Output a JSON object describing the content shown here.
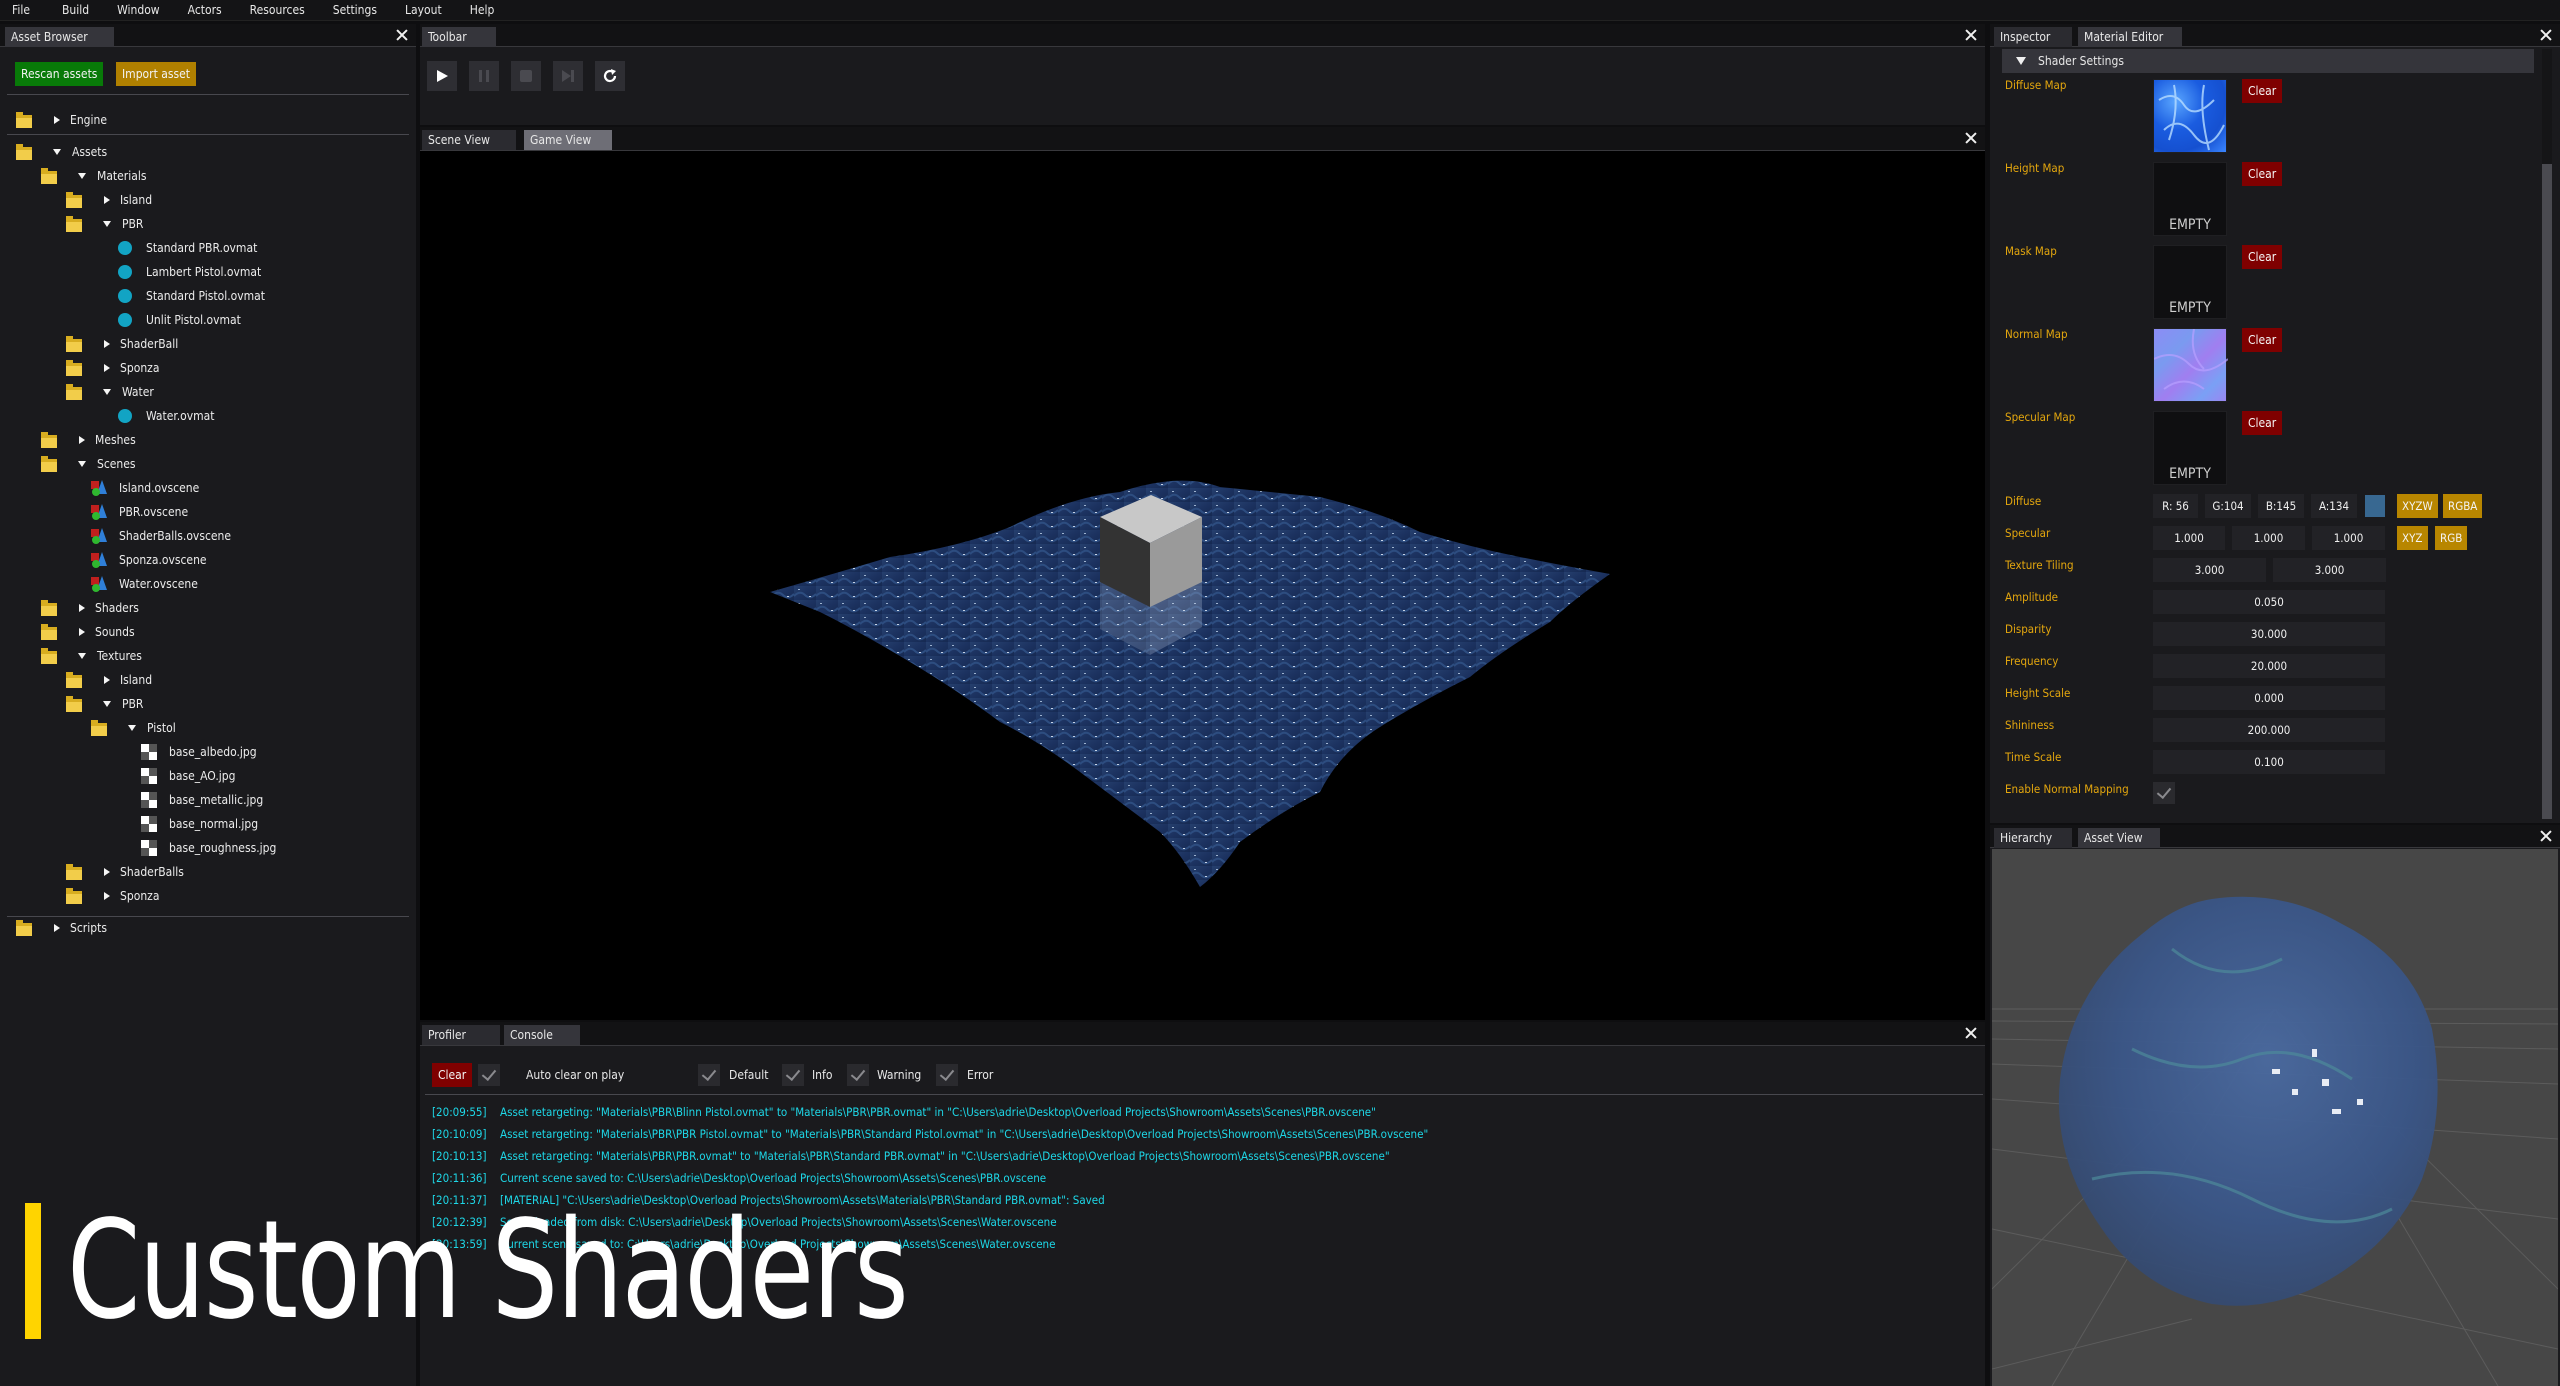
{
  "menu": [
    "File",
    "Build",
    "Window",
    "Actors",
    "Resources",
    "Settings",
    "Layout",
    "Help"
  ],
  "asset_browser": {
    "tab": "Asset Browser",
    "rescan_label": "Rescan assets",
    "import_label": "Import asset",
    "tree": [
      {
        "label": "Engine",
        "icon": "folder",
        "depth": 0,
        "state": "collapsed",
        "group": "engine"
      },
      {
        "label": "Assets",
        "icon": "folder",
        "depth": 0,
        "state": "expanded",
        "group": "assets"
      },
      {
        "label": "Materials",
        "icon": "folder",
        "depth": 1,
        "state": "expanded"
      },
      {
        "label": "Island",
        "icon": "folder",
        "depth": 2,
        "state": "collapsed"
      },
      {
        "label": "PBR",
        "icon": "folder",
        "depth": 2,
        "state": "expanded"
      },
      {
        "label": "Standard PBR.ovmat",
        "icon": "material",
        "depth": 3
      },
      {
        "label": "Lambert Pistol.ovmat",
        "icon": "material",
        "depth": 3
      },
      {
        "label": "Standard Pistol.ovmat",
        "icon": "material",
        "depth": 3
      },
      {
        "label": "Unlit Pistol.ovmat",
        "icon": "material",
        "depth": 3
      },
      {
        "label": "ShaderBall",
        "icon": "folder",
        "depth": 2,
        "state": "collapsed"
      },
      {
        "label": "Sponza",
        "icon": "folder",
        "depth": 2,
        "state": "collapsed"
      },
      {
        "label": "Water",
        "icon": "folder",
        "depth": 2,
        "state": "expanded"
      },
      {
        "label": "Water.ovmat",
        "icon": "material",
        "depth": 3
      },
      {
        "label": "Meshes",
        "icon": "folder",
        "depth": 1,
        "state": "collapsed"
      },
      {
        "label": "Scenes",
        "icon": "folder",
        "depth": 1,
        "state": "expanded"
      },
      {
        "label": "Island.ovscene",
        "icon": "scene",
        "depth": 2
      },
      {
        "label": "PBR.ovscene",
        "icon": "scene",
        "depth": 2
      },
      {
        "label": "ShaderBalls.ovscene",
        "icon": "scene",
        "depth": 2
      },
      {
        "label": "Sponza.ovscene",
        "icon": "scene",
        "depth": 2
      },
      {
        "label": "Water.ovscene",
        "icon": "scene",
        "depth": 2
      },
      {
        "label": "Shaders",
        "icon": "folder",
        "depth": 1,
        "state": "collapsed"
      },
      {
        "label": "Sounds",
        "icon": "folder",
        "depth": 1,
        "state": "collapsed"
      },
      {
        "label": "Textures",
        "icon": "folder",
        "depth": 1,
        "state": "expanded"
      },
      {
        "label": "Island",
        "icon": "folder",
        "depth": 2,
        "state": "collapsed"
      },
      {
        "label": "PBR",
        "icon": "folder",
        "depth": 2,
        "state": "expanded"
      },
      {
        "label": "Pistol",
        "icon": "folder",
        "depth": 3,
        "state": "expanded"
      },
      {
        "label": "base_albedo.jpg",
        "icon": "texture",
        "depth": 4
      },
      {
        "label": "base_AO.jpg",
        "icon": "texture",
        "depth": 4
      },
      {
        "label": "base_metallic.jpg",
        "icon": "texture",
        "depth": 4
      },
      {
        "label": "base_normal.jpg",
        "icon": "texture",
        "depth": 4
      },
      {
        "label": "base_roughness.jpg",
        "icon": "texture",
        "depth": 4
      },
      {
        "label": "ShaderBalls",
        "icon": "folder",
        "depth": 2,
        "state": "collapsed"
      },
      {
        "label": "Sponza",
        "icon": "folder",
        "depth": 2,
        "state": "collapsed"
      },
      {
        "label": "Scripts",
        "icon": "folder",
        "depth": 0,
        "state": "collapsed",
        "group": "scripts"
      }
    ]
  },
  "toolbar": {
    "tab": "Toolbar",
    "buttons": [
      {
        "name": "play",
        "enabled": true
      },
      {
        "name": "pause",
        "enabled": false
      },
      {
        "name": "stop",
        "enabled": false
      },
      {
        "name": "next-frame",
        "enabled": false
      },
      {
        "name": "refresh",
        "enabled": true
      }
    ]
  },
  "viewport": {
    "tabs": [
      "Scene View",
      "Game View"
    ],
    "active_tab": "Game View"
  },
  "console": {
    "tabs": [
      "Profiler",
      "Console"
    ],
    "active_tab": "Console",
    "clear_label": "Clear",
    "auto_clear_label": "Auto clear on play",
    "auto_clear_checked": true,
    "filters": [
      {
        "label": "Default",
        "checked": true
      },
      {
        "label": "Info",
        "checked": true
      },
      {
        "label": "Warning",
        "checked": true
      },
      {
        "label": "Error",
        "checked": true
      }
    ],
    "logs": [
      {
        "time": "[20:09:55]",
        "message": "Asset retargeting: \"Materials\\PBR\\Blinn Pistol.ovmat\" to \"Materials\\PBR\\PBR.ovmat\" in \"C:\\Users\\adrie\\Desktop\\Overload Projects\\Showroom\\Assets\\Scenes\\PBR.ovscene\""
      },
      {
        "time": "[20:10:09]",
        "message": "Asset retargeting: \"Materials\\PBR\\PBR Pistol.ovmat\" to \"Materials\\PBR\\Standard Pistol.ovmat\" in \"C:\\Users\\adrie\\Desktop\\Overload Projects\\Showroom\\Assets\\Scenes\\PBR.ovscene\""
      },
      {
        "time": "[20:10:13]",
        "message": "Asset retargeting: \"Materials\\PBR\\PBR.ovmat\" to \"Materials\\PBR\\Standard PBR.ovmat\" in \"C:\\Users\\adrie\\Desktop\\Overload Projects\\Showroom\\Assets\\Scenes\\PBR.ovscene\""
      },
      {
        "time": "[20:11:36]",
        "message": "Current scene saved to: C:\\Users\\adrie\\Desktop\\Overload Projects\\Showroom\\Assets\\Scenes\\PBR.ovscene"
      },
      {
        "time": "[20:11:37]",
        "message": "[MATERIAL] \"C:\\Users\\adrie\\Desktop\\Overload Projects\\Showroom\\Assets\\Materials\\PBR\\Standard PBR.ovmat\": Saved"
      },
      {
        "time": "[20:12:39]",
        "message": "Scene loaded from disk: C:\\Users\\adrie\\Desktop\\Overload Projects\\Showroom\\Assets\\Scenes\\Water.ovscene"
      },
      {
        "time": "[20:13:59]",
        "message": "Current scene saved to: C:\\Users\\adrie\\Desktop\\Overload Projects\\Showroom\\Assets\\Scenes\\Water.ovscene"
      }
    ]
  },
  "material_editor": {
    "tabs": [
      "Inspector",
      "Material Editor"
    ],
    "active_tab": "Material Editor",
    "section": "Shader Settings",
    "clear_label": "Clear",
    "empty_label": "EMPTY",
    "maps": [
      {
        "label": "Diffuse Map",
        "texture": "water-diffuse"
      },
      {
        "label": "Height Map",
        "texture": null
      },
      {
        "label": "Mask Map",
        "texture": null
      },
      {
        "label": "Normal Map",
        "texture": "water-normal"
      },
      {
        "label": "Specular Map",
        "texture": null
      }
    ],
    "diffuse": {
      "label": "Diffuse",
      "r": "R: 56",
      "g": "G:104",
      "b": "B:145",
      "a": "A:134",
      "swatch": "#386891",
      "btn_xyzw": "XYZW",
      "btn_rgba": "RGBA"
    },
    "specular": {
      "label": "Specular",
      "values": [
        "1.000",
        "1.000",
        "1.000"
      ],
      "btn_xyz": "XYZ",
      "btn_rgb": "RGB"
    },
    "texture_tiling": {
      "label": "Texture Tiling",
      "values": [
        "3.000",
        "3.000"
      ]
    },
    "scalars": [
      {
        "label": "Amplitude",
        "value": "0.050"
      },
      {
        "label": "Disparity",
        "value": "30.000"
      },
      {
        "label": "Frequency",
        "value": "20.000"
      },
      {
        "label": "Height Scale",
        "value": "0.000"
      },
      {
        "label": "Shininess",
        "value": "200.000"
      },
      {
        "label": "Time Scale",
        "value": "0.100"
      }
    ],
    "normal_mapping": {
      "label": "Enable Normal Mapping",
      "checked": true
    }
  },
  "asset_view": {
    "tabs": [
      "Hierarchy",
      "Asset View"
    ],
    "active_tab": "Asset View"
  },
  "overlay": {
    "title": "Custom Shaders",
    "accent": "#ffd400"
  },
  "colors": {
    "label_gold": "#e4a70e",
    "console_text": "#1ed8e8",
    "clear_red": "#7f0000",
    "rescan_green": "#087a08",
    "import_gold": "#b08000"
  }
}
